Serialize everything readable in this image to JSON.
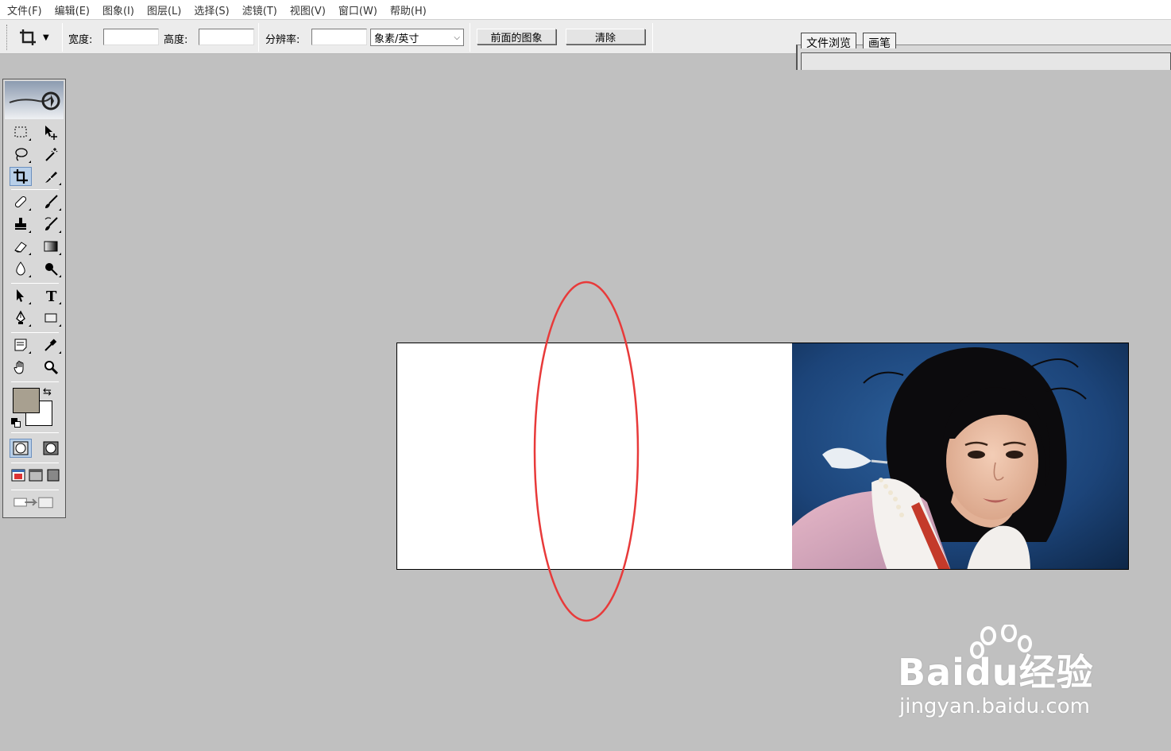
{
  "menu": [
    "文件(F)",
    "编辑(E)",
    "图象(I)",
    "图层(L)",
    "选择(S)",
    "滤镜(T)",
    "视图(V)",
    "窗口(W)",
    "帮助(H)"
  ],
  "options": {
    "width_label": "宽度:",
    "width_value": "",
    "height_label": "高度:",
    "height_value": "",
    "resolution_label": "分辨率:",
    "resolution_value": "",
    "unit_selected": "象素/英寸",
    "front_image_button": "前面的图象",
    "clear_button": "清除"
  },
  "palette_well": {
    "tabs": [
      "文件浏览",
      "画笔"
    ]
  },
  "toolbox": {
    "tools": [
      "marquee",
      "move",
      "lasso",
      "magic-wand",
      "crop",
      "slice",
      "healing-brush",
      "brush",
      "clone-stamp",
      "history-brush",
      "eraser",
      "gradient",
      "blur",
      "dodge",
      "path-selection",
      "type",
      "pen",
      "rectangle-shape",
      "notes",
      "eyedropper",
      "hand",
      "zoom"
    ],
    "selected_tool": "crop",
    "foreground_color": "#a8a090",
    "background_color": "#ffffff"
  },
  "watermark": {
    "brand": "Bai",
    "brand2": "du",
    "brand_cn": "经验",
    "url": "jingyan.baidu.com"
  },
  "colors": {
    "annotation": "#e83a3a",
    "workspace": "#c0c0c0",
    "photo_bg": "#1d4477"
  }
}
